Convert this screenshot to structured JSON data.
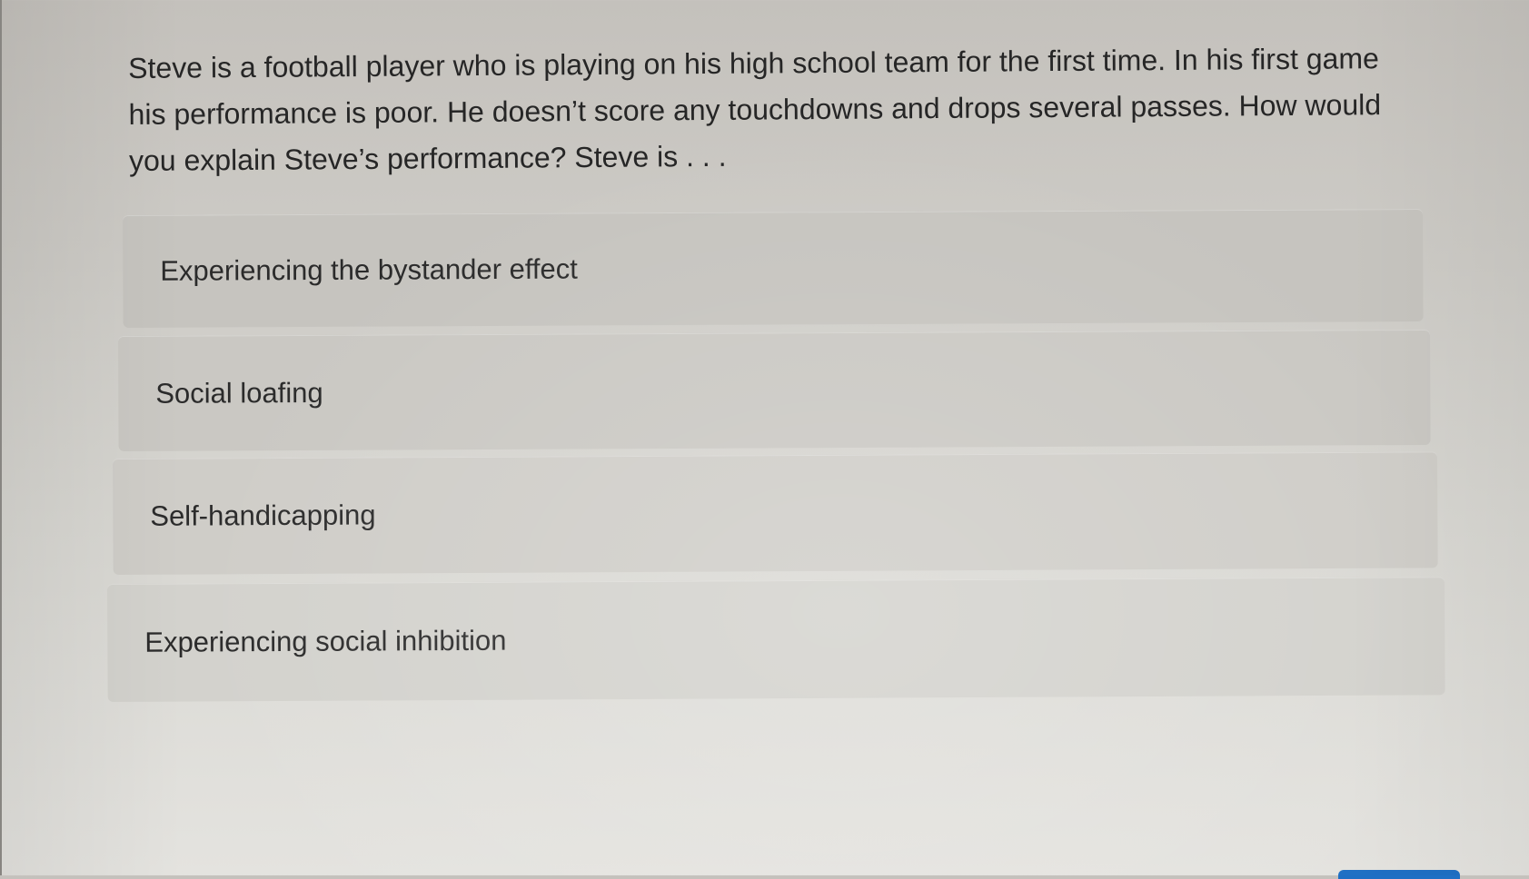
{
  "question": {
    "text": "Steve is a football player who is playing on his high school team for the first time. In his first game his performance is poor. He doesn’t score any touchdowns and drops several passes. How would you explain Steve’s performance? Steve is . . ."
  },
  "options": [
    {
      "label": "Experiencing the bystander effect"
    },
    {
      "label": "Social loafing"
    },
    {
      "label": "Self-handicapping"
    },
    {
      "label": "Experiencing social inhibition"
    }
  ],
  "colors": {
    "background": "#cdcbc6",
    "option_background": "#c9c7c2",
    "text": "#262626",
    "button_accent": "#1e6fc4"
  }
}
